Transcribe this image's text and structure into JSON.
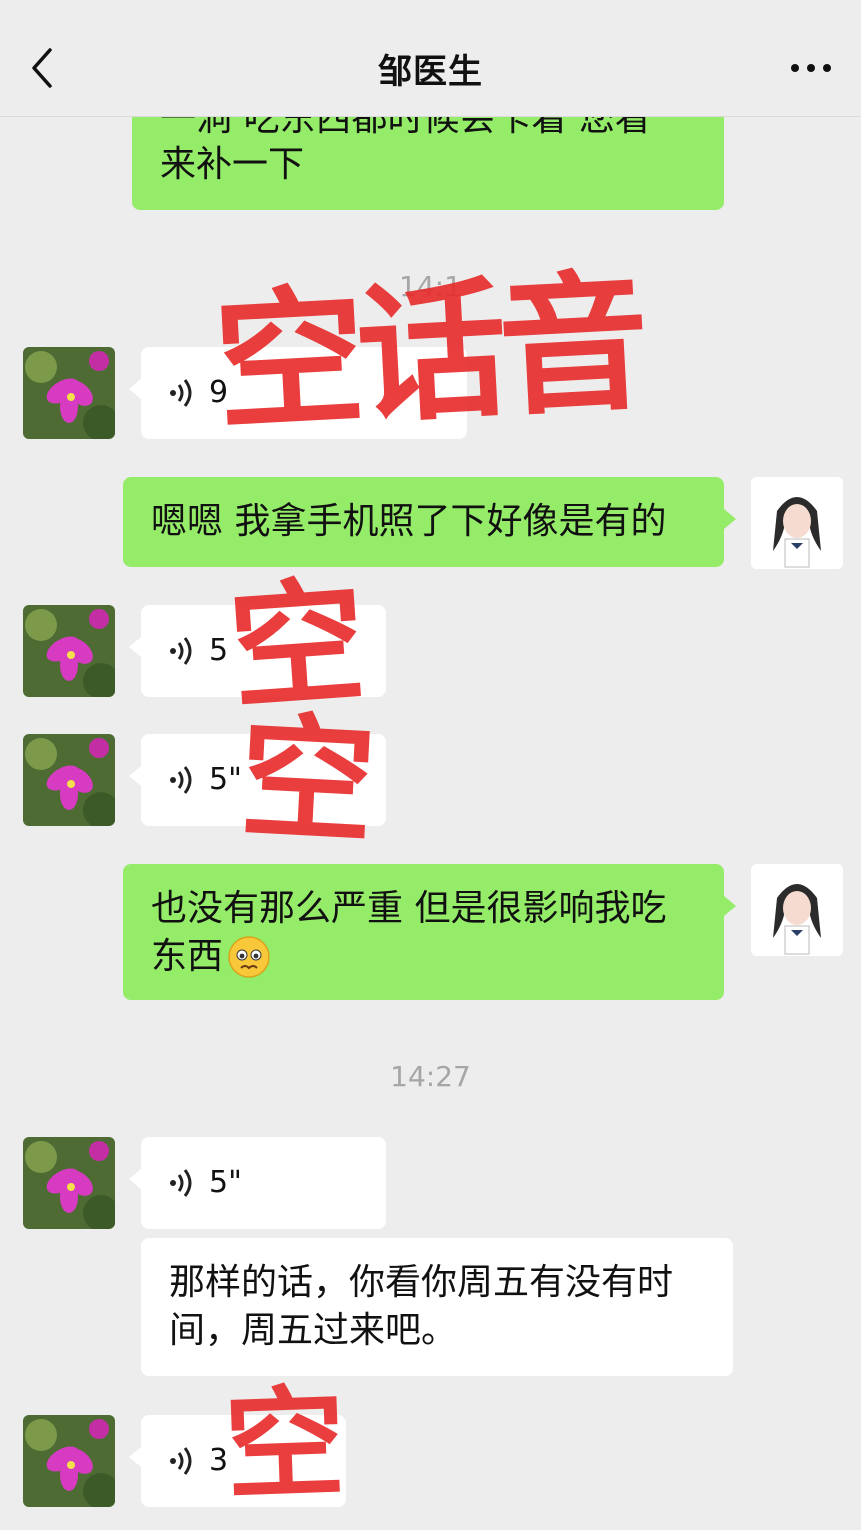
{
  "header": {
    "title": "邹医生"
  },
  "icons": {
    "back": "chevron-left-icon",
    "more": "more-dots-icon",
    "voice": "voice-wave-icon"
  },
  "colors": {
    "sent_bubble": "#95ec69",
    "recv_bubble": "#ffffff",
    "background": "#ededed",
    "stamp": "#e82a2a"
  },
  "messages": {
    "m1_line1": "一洞 吃东西都时候会卡着 您看",
    "m1_line2": "来补一下",
    "time1": "14:1",
    "v1": "9",
    "m2": "嗯嗯 我拿手机照了下好像是有的",
    "v2": "5",
    "v3": "5\"",
    "m3_line1": "也没有那么严重 但是很影响我吃",
    "m3_line2": "东西",
    "time2": "14:27",
    "v4": "5\"",
    "m4_line1": "那样的话，你看你周五有没有时",
    "m4_line2": "间，周五过来吧。",
    "v5": "3"
  },
  "stamps": {
    "s1": "空话音",
    "s2": "空",
    "s3": "空",
    "s4": "空"
  }
}
